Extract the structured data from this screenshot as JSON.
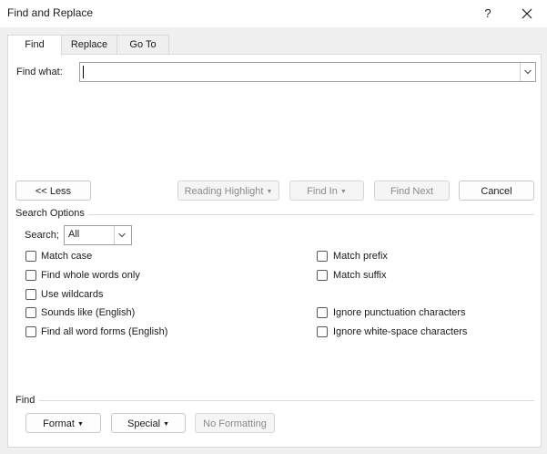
{
  "window": {
    "title": "Find and Replace",
    "help_label": "?"
  },
  "tabs": [
    {
      "label": "Find",
      "active": true
    },
    {
      "label": "Replace",
      "active": false
    },
    {
      "label": "Go To",
      "active": false
    }
  ],
  "find_what": {
    "label": "Find what:",
    "value": ""
  },
  "buttons": {
    "less": "<< Less",
    "reading_highlight": "Reading Highlight",
    "find_in": "Find In",
    "find_next": "Find Next",
    "cancel": "Cancel"
  },
  "search_options": {
    "heading": "Search Options",
    "search_label": "Search;",
    "search_value": "All",
    "checkboxes_left": [
      {
        "label": "Match case",
        "checked": false
      },
      {
        "label": "Find whole words only",
        "checked": false
      },
      {
        "label": "Use wildcards",
        "checked": false
      },
      {
        "label": "Sounds like (English)",
        "checked": false
      },
      {
        "label": "Find all word forms (English)",
        "checked": false
      }
    ],
    "checkboxes_right": [
      {
        "label": "Match prefix",
        "checked": false
      },
      {
        "label": "Match suffix",
        "checked": false
      },
      {
        "label": "Ignore punctuation characters",
        "checked": false
      },
      {
        "label": "Ignore white-space characters",
        "checked": false
      }
    ]
  },
  "find_section": {
    "heading": "Find",
    "format": "Format",
    "special": "Special",
    "no_formatting": "No Formatting"
  },
  "colors": {
    "dialog_bg": "#f0f0f0",
    "panel_bg": "#ffffff",
    "disabled_text": "#8a8a8a"
  }
}
